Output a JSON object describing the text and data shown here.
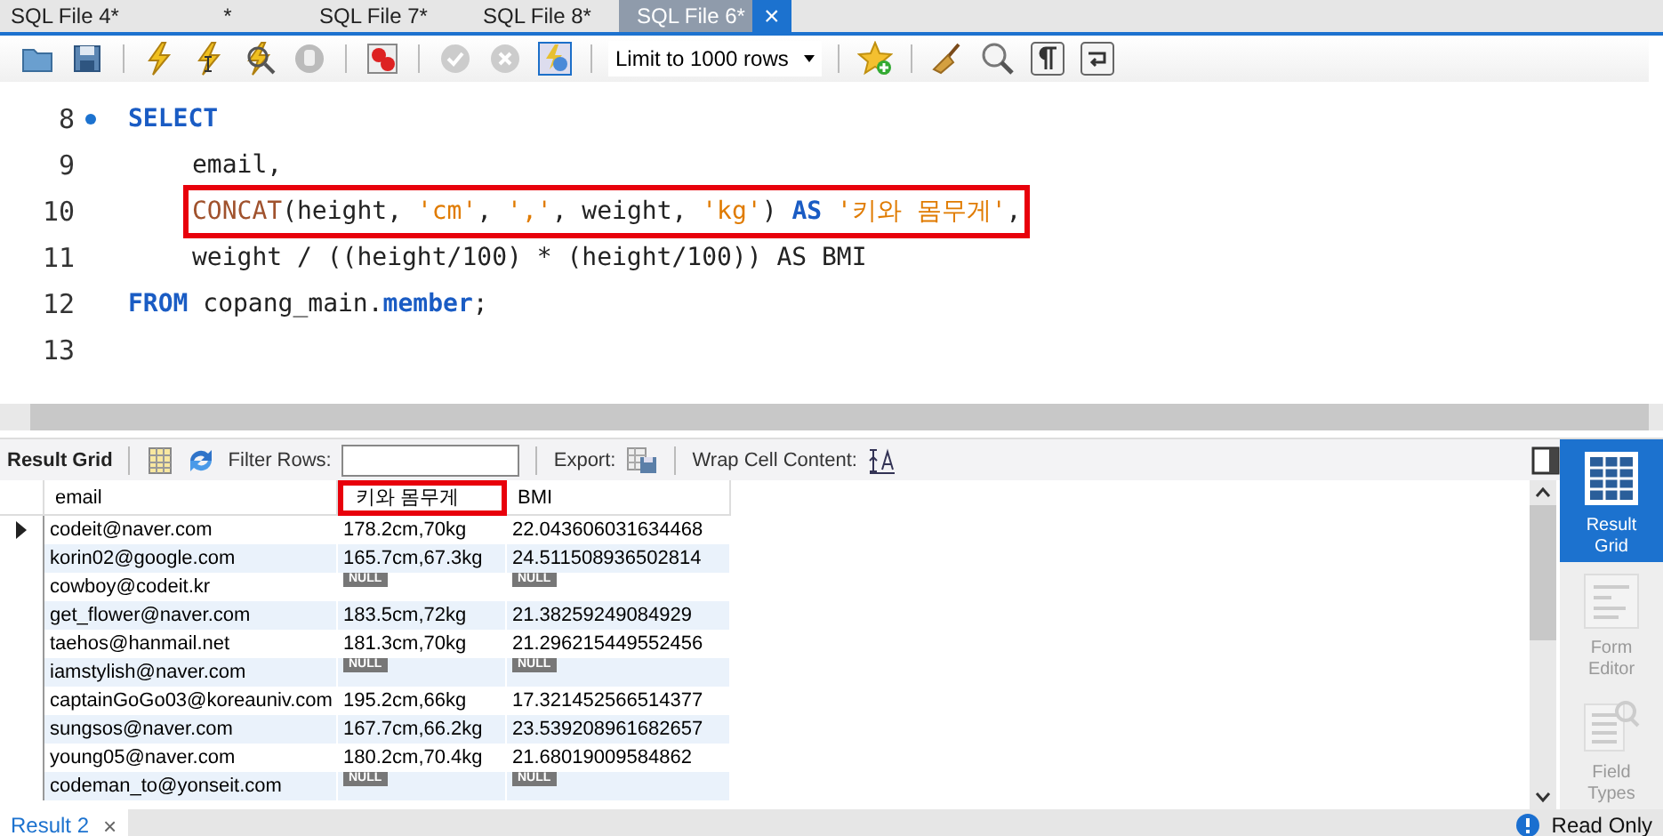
{
  "tabs": [
    {
      "label": "SQL File 4*",
      "selected": false
    },
    {
      "label": "*",
      "selected": false
    },
    {
      "label": "SQL File 7*",
      "selected": false
    },
    {
      "label": "SQL File 8*",
      "selected": false
    },
    {
      "label": "SQL File 6*",
      "selected": true,
      "close": "×"
    }
  ],
  "toolbar": {
    "limit": "Limit to 1000 rows"
  },
  "editor": {
    "lines": [
      {
        "number": "8",
        "marker": true,
        "highlighted": false,
        "tokens": [
          {
            "kind": "keyword",
            "text": "SELECT"
          }
        ],
        "children": [
          {
            "number": "9",
            "marker": false,
            "highlighted": false,
            "tokens": [
              {
                "kind": "plain",
                "text": "email,"
              }
            ]
          },
          {
            "number": "10",
            "marker": false,
            "highlighted": true,
            "tokens": [
              {
                "kind": "func",
                "text": "CONCAT"
              },
              {
                "kind": "plain",
                "text": "(height, "
              },
              {
                "kind": "string",
                "text": "'cm'"
              },
              {
                "kind": "plain",
                "text": ", "
              },
              {
                "kind": "string",
                "text": "','"
              },
              {
                "kind": "plain",
                "text": ", weight, "
              },
              {
                "kind": "string",
                "text": "'kg'"
              },
              {
                "kind": "plain",
                "text": ") "
              },
              {
                "kind": "keyword",
                "text": "AS"
              },
              {
                "kind": "string",
                "text": "'키와 몸무게'"
              },
              {
                "kind": "plain",
                "text": ","
              }
            ]
          },
          {
            "number": "11",
            "marker": false,
            "highlighted": false,
            "tokens": [
              {
                "kind": "plain",
                "text": "weight / ((height/100) * (height/100)) AS BMI"
              }
            ]
          }
        ]
      },
      {
        "number": "12",
        "marker": false,
        "highlighted": false,
        "tokens": [
          {
            "kind": "keyword",
            "text": "FROM"
          },
          {
            "kind": "plain",
            "text": " copang_main."
          },
          {
            "kind": "keyword",
            "text": "member"
          },
          {
            "kind": "plain",
            "text": ";"
          }
        ]
      },
      {
        "number": "13",
        "marker": false
      }
    ]
  },
  "result_toolbar": {
    "title": "Result Grid",
    "filter_label": "Filter Rows:",
    "export_label": "Export:",
    "wrap_label": "Wrap Cell Content:"
  },
  "grid": {
    "columns": [
      {
        "label": "email",
        "highlighted": false
      },
      {
        "label": "키와 몸무게",
        "highlighted": true
      },
      {
        "label": "BMI",
        "highlighted": false
      }
    ],
    "rows": [
      {
        "current": true,
        "cells": [
          {
            "kind": "text",
            "text": "codeit@naver.com"
          },
          {
            "kind": "text",
            "text": "178.2cm,70kg"
          },
          {
            "kind": "text",
            "text": "22.043606031634468"
          }
        ]
      },
      {
        "current": false,
        "cells": [
          {
            "kind": "text",
            "text": "korin02@google.com"
          },
          {
            "kind": "text",
            "text": "165.7cm,67.3kg"
          },
          {
            "kind": "text",
            "text": "24.511508936502814"
          }
        ]
      },
      {
        "current": false,
        "cells": [
          {
            "kind": "text",
            "text": "cowboy@codeit.kr"
          },
          {
            "kind": "null",
            "text": "NULL"
          },
          {
            "kind": "null",
            "text": "NULL"
          }
        ]
      },
      {
        "current": false,
        "cells": [
          {
            "kind": "text",
            "text": "get_flower@naver.com"
          },
          {
            "kind": "text",
            "text": "183.5cm,72kg"
          },
          {
            "kind": "text",
            "text": "21.38259249084929"
          }
        ]
      },
      {
        "current": false,
        "cells": [
          {
            "kind": "text",
            "text": "taehos@hanmail.net"
          },
          {
            "kind": "text",
            "text": "181.3cm,70kg"
          },
          {
            "kind": "text",
            "text": "21.296215449552456"
          }
        ]
      },
      {
        "current": false,
        "cells": [
          {
            "kind": "text",
            "text": "iamstylish@naver.com"
          },
          {
            "kind": "null",
            "text": "NULL"
          },
          {
            "kind": "null",
            "text": "NULL"
          }
        ]
      },
      {
        "current": false,
        "cells": [
          {
            "kind": "text",
            "text": "captainGoGo03@koreauniv.com"
          },
          {
            "kind": "text",
            "text": "195.2cm,66kg"
          },
          {
            "kind": "text",
            "text": "17.321452566514377"
          }
        ]
      },
      {
        "current": false,
        "cells": [
          {
            "kind": "text",
            "text": "sungsos@naver.com"
          },
          {
            "kind": "text",
            "text": "167.7cm,66.2kg"
          },
          {
            "kind": "text",
            "text": "23.539208961682657"
          }
        ]
      },
      {
        "current": false,
        "cells": [
          {
            "kind": "text",
            "text": "young05@naver.com"
          },
          {
            "kind": "text",
            "text": "180.2cm,70.4kg"
          },
          {
            "kind": "text",
            "text": "21.68019009584862"
          }
        ]
      },
      {
        "current": false,
        "cells": [
          {
            "kind": "text",
            "text": "codeman_to@yonseit.com"
          },
          {
            "kind": "null",
            "text": "NULL"
          },
          {
            "kind": "null",
            "text": "NULL"
          }
        ]
      }
    ]
  },
  "side_panel": [
    {
      "label": "Result Grid",
      "selected": true
    },
    {
      "label": "Form Editor",
      "selected": false
    },
    {
      "label": "Field Types",
      "selected": false
    }
  ],
  "status_bar": {
    "tab": "Result 2",
    "close": "×",
    "mode": "Read Only"
  }
}
